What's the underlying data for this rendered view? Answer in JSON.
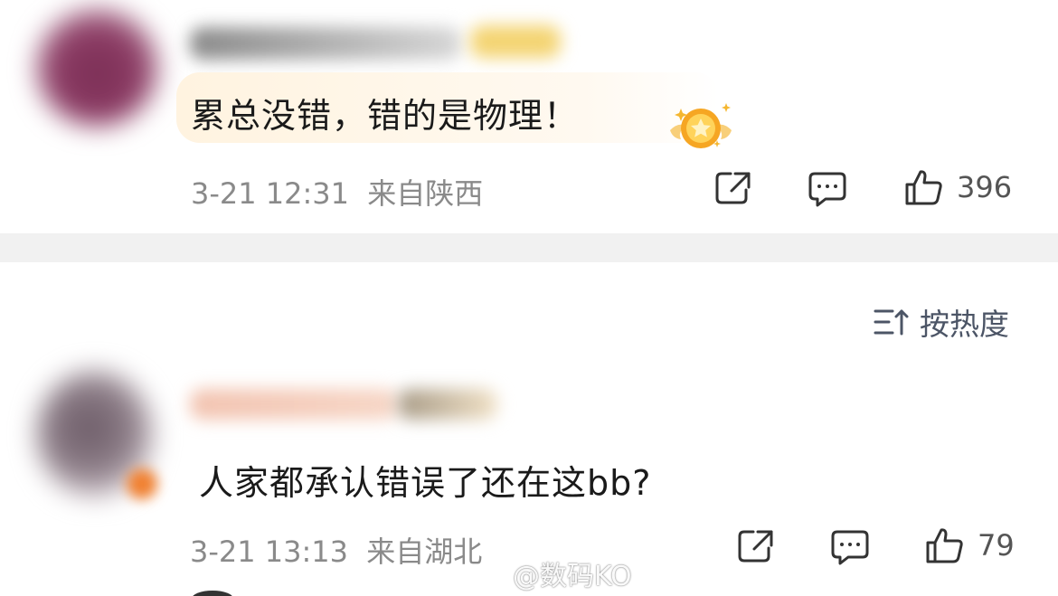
{
  "comments": [
    {
      "text": "累总没错，错的是物理！",
      "time": "3-21 12:31",
      "location": "来自陕西",
      "likes": "396",
      "has_badge_bubble": true,
      "username_redacted": true
    },
    {
      "text": "人家都承认错误了还在这bb?",
      "time": "3-21 13:13",
      "location": "来自湖北",
      "likes": "79",
      "has_badge_bubble": false,
      "username_redacted": true
    }
  ],
  "sort": {
    "label": "按热度"
  },
  "watermark": {
    "text": "@数码KO"
  },
  "icons": {
    "share": "share-icon",
    "comment": "comment-icon",
    "like": "like-icon",
    "sort": "sort-icon",
    "medal": "medal-icon",
    "weibo": "weibo-icon"
  },
  "colors": {
    "divider": "#f1f1f1",
    "bubble": "#fff3e0",
    "meta_text": "#8a8a8a",
    "sort_text": "#4c5566"
  }
}
